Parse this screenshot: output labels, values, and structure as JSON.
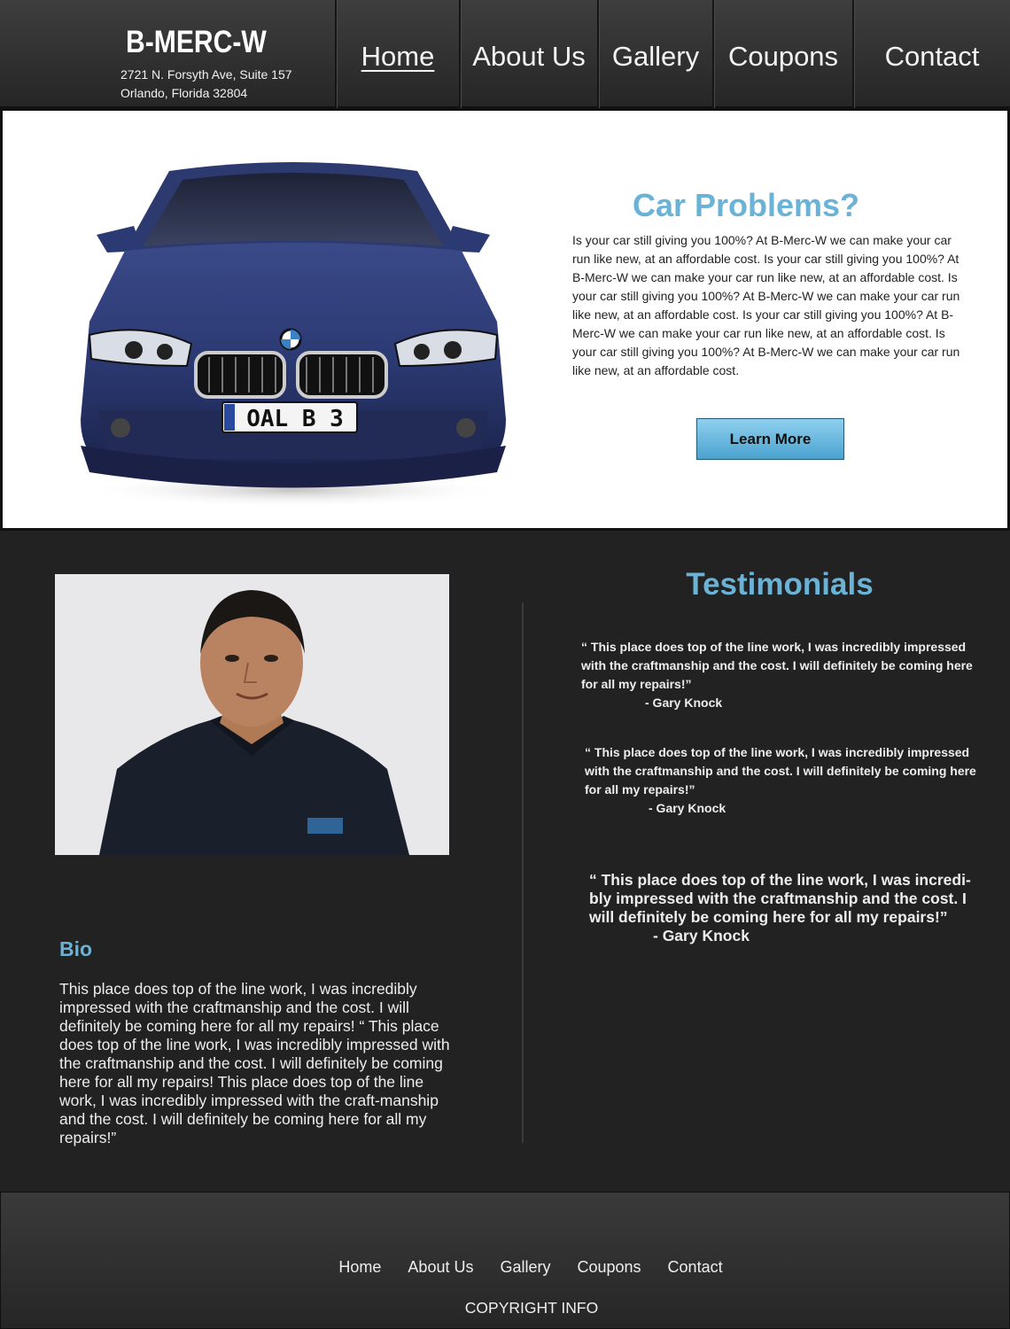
{
  "header": {
    "brand": "B-MERC-W",
    "address_line1": "2721 N. Forsyth Ave, Suite 157",
    "address_line2": "Orlando, Florida 32804",
    "nav": [
      {
        "label": "Home",
        "active": true
      },
      {
        "label": "About Us",
        "active": false
      },
      {
        "label": "Gallery",
        "active": false
      },
      {
        "label": "Coupons",
        "active": false
      },
      {
        "label": "Contact",
        "active": false
      }
    ]
  },
  "hero": {
    "image": "car-image",
    "plate": "OAL B 3",
    "title": "Car Problems?",
    "text": "Is your car still giving you 100%? At B-Merc-W we can make your car run like new, at an affordable cost. Is your car still giving you 100%? At B-Merc-W we can make your car run like new, at an affordable cost. Is your car still giving you 100%? At B-Merc-W we can make your car run like new, at an affordable cost. Is your car still giving you 100%? At B-Merc-W we can make your car run like new, at an affordable cost. Is your car still giving you 100%? At B-Merc-W we can make your car run like new, at an affordable cost.",
    "button": "Learn More"
  },
  "bio": {
    "photo": "portrait-photo",
    "title": "Bio",
    "text": "This place does top of the line work, I was incredibly impressed with the craftmanship and the cost. I will definitely be coming here for all my repairs! “ This place does top of the line work, I was incredibly impressed with the craftmanship and the cost. I will definitely be coming here for all my repairs!  This place does top of the line work, I was incredibly impressed with the craft-manship and the cost. I will definitely be coming here for all my repairs!”"
  },
  "testimonials": {
    "title": "Testimonials",
    "items": [
      {
        "quote": "“ This place does top of the line work, I was incredibly impressed with the craftmanship and the cost. I will definitely be coming here for all my repairs!”",
        "author": "- Gary Knock"
      },
      {
        "quote": "“ This place does top of the line work, I was incredibly impressed with the craftmanship and the cost. I will definitely be coming here for all my repairs!”",
        "author": "- Gary Knock"
      },
      {
        "quote": "“ This place does top of the line work, I was incredi-bly impressed with the craftmanship and the cost. I will definitely be coming here for all my repairs!”",
        "author": "- Gary Knock"
      }
    ]
  },
  "footer": {
    "nav": [
      "Home",
      "About Us",
      "Gallery",
      "Coupons",
      "Contact"
    ],
    "copyright": "COPYRIGHT INFO"
  },
  "colors": {
    "accent": "#6ab3d6",
    "background": "#222222",
    "button": "#5ab0d8"
  }
}
